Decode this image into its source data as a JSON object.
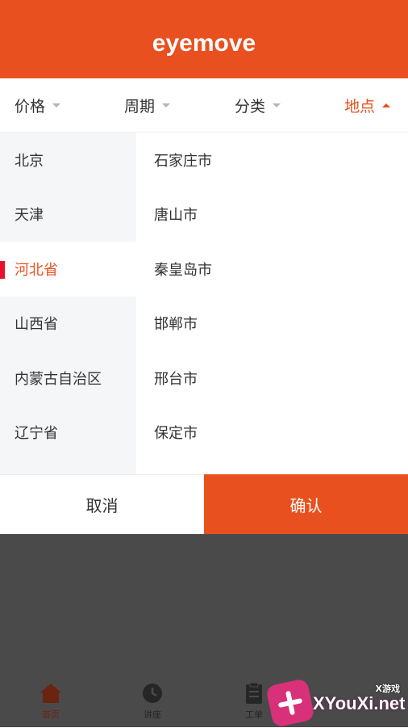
{
  "header": {
    "logo_text": "eyemove"
  },
  "filters": [
    {
      "label": "价格",
      "active": false
    },
    {
      "label": "周期",
      "active": false
    },
    {
      "label": "分类",
      "active": false
    },
    {
      "label": "地点",
      "active": true
    }
  ],
  "provinces": [
    {
      "label": "北京"
    },
    {
      "label": "天津"
    },
    {
      "label": "河北省",
      "selected": true
    },
    {
      "label": "山西省"
    },
    {
      "label": "内蒙古自治区"
    },
    {
      "label": "辽宁省"
    }
  ],
  "cities": [
    {
      "label": "石家庄市"
    },
    {
      "label": "唐山市"
    },
    {
      "label": "秦皇岛市"
    },
    {
      "label": "邯郸市"
    },
    {
      "label": "邢台市"
    },
    {
      "label": "保定市"
    }
  ],
  "actions": {
    "cancel_label": "取消",
    "confirm_label": "确认"
  },
  "tabbar": [
    {
      "label": "首页",
      "icon": "home-icon",
      "active": true
    },
    {
      "label": "讲座",
      "icon": "clock-icon",
      "active": false
    },
    {
      "label": "工单",
      "icon": "clipboard-icon",
      "active": false
    }
  ],
  "watermark": {
    "top_text": "X游戏",
    "main_text": "XYouXi.net"
  },
  "colors": {
    "accent": "#e8511f",
    "indicator": "#e8102a",
    "overlay": "#4a4a4a"
  }
}
